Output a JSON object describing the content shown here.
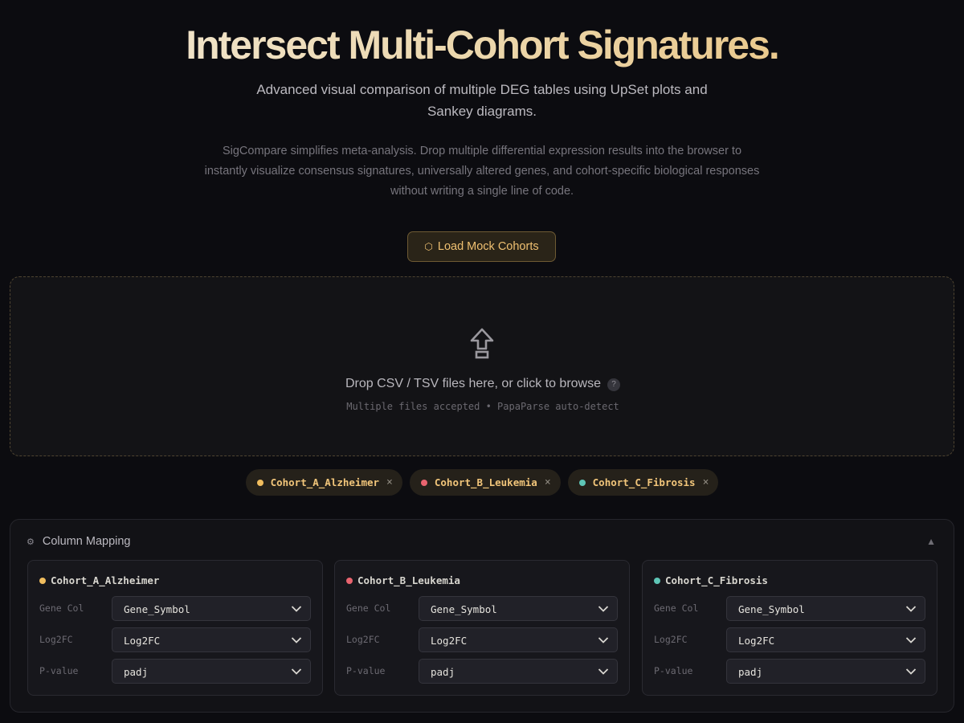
{
  "hero": {
    "title": "Intersect Multi-Cohort Signatures.",
    "subtitle": "Advanced visual comparison of multiple DEG tables using UpSet plots and Sankey diagrams.",
    "description": "SigCompare simplifies meta-analysis. Drop multiple differential expression results into the browser to instantly visualize consensus signatures, universally altered genes, and cohort-specific biological responses without writing a single line of code.",
    "load_button": "Load Mock Cohorts",
    "load_icon": "⬡"
  },
  "dropzone": {
    "text": "Drop CSV / TSV files here, or click to browse",
    "help": "?",
    "subtext": "Multiple files accepted • PapaParse auto-detect"
  },
  "cohorts": [
    {
      "name": "Cohort_A_Alzheimer",
      "color": "#f0bd5e",
      "remove": "×"
    },
    {
      "name": "Cohort_B_Leukemia",
      "color": "#e9646f",
      "remove": "×"
    },
    {
      "name": "Cohort_C_Fibrosis",
      "color": "#5ec5b6",
      "remove": "×"
    }
  ],
  "mapping": {
    "gear_icon": "⚙",
    "title": "Column Mapping",
    "collapse_icon": "▲",
    "labels": {
      "gene": "Gene Col",
      "log2fc": "Log2FC",
      "pvalue": "P-value"
    },
    "cards": [
      {
        "name": "Cohort_A_Alzheimer",
        "gene": "Gene_Symbol",
        "log2fc": "Log2FC",
        "pvalue": "padj"
      },
      {
        "name": "Cohort_B_Leukemia",
        "gene": "Gene_Symbol",
        "log2fc": "Log2FC",
        "pvalue": "padj"
      },
      {
        "name": "Cohort_C_Fibrosis",
        "gene": "Gene_Symbol",
        "log2fc": "Log2FC",
        "pvalue": "padj"
      }
    ]
  }
}
